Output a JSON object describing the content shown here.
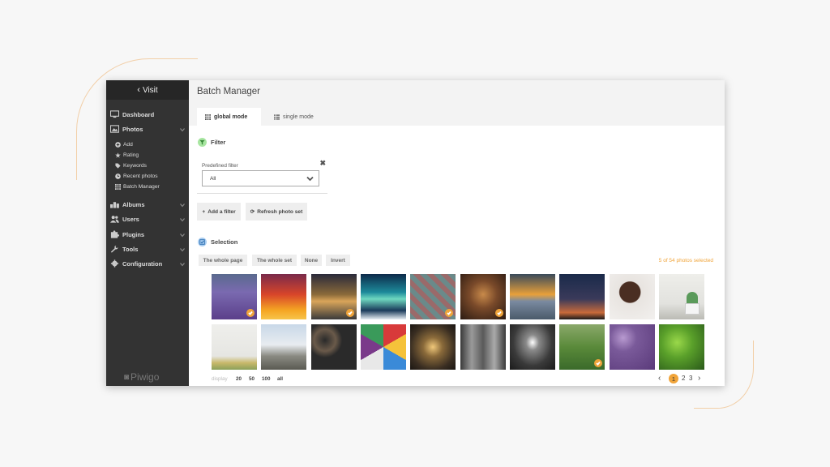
{
  "sidebar": {
    "visit": "Visit",
    "items": [
      {
        "label": "Dashboard",
        "icon": "dashboard-icon"
      },
      {
        "label": "Photos",
        "icon": "photo-icon"
      },
      {
        "label": "Albums",
        "icon": "albums-icon"
      },
      {
        "label": "Users",
        "icon": "users-icon"
      },
      {
        "label": "Plugins",
        "icon": "puzzle-icon"
      },
      {
        "label": "Tools",
        "icon": "wrench-icon"
      },
      {
        "label": "Configuration",
        "icon": "gear-icon"
      }
    ],
    "photos_sub": [
      {
        "label": "Add",
        "icon": "plus-circle-icon"
      },
      {
        "label": "Rating",
        "icon": "star-icon"
      },
      {
        "label": "Keywords",
        "icon": "tag-icon"
      },
      {
        "label": "Recent photos",
        "icon": "clock-icon"
      },
      {
        "label": "Batch Manager",
        "icon": "grid-icon"
      }
    ],
    "logo": "Piwigo"
  },
  "header": {
    "title": "Batch Manager",
    "tabs": [
      {
        "label": "global mode",
        "active": true
      },
      {
        "label": "single mode",
        "active": false
      }
    ]
  },
  "filter": {
    "title": "Filter",
    "predefined_label": "Predefined filter",
    "predefined_value": "All",
    "close": "✖",
    "add_filter": "Add a filter",
    "refresh": "Refresh photo set"
  },
  "selection": {
    "title": "Selection",
    "buttons": [
      "The whole page",
      "The whole set",
      "None",
      "Invert"
    ],
    "count": "5 of 54 photos selected"
  },
  "thumbnails": [
    {
      "name": "lavender",
      "checked": true
    },
    {
      "name": "sunset-sky",
      "checked": false
    },
    {
      "name": "lake-sunset",
      "checked": true
    },
    {
      "name": "aurora",
      "checked": false
    },
    {
      "name": "glass-tiles",
      "checked": true
    },
    {
      "name": "tiger",
      "checked": true
    },
    {
      "name": "mountain-mist",
      "checked": false
    },
    {
      "name": "silhouette-dusk",
      "checked": false
    },
    {
      "name": "puppy",
      "checked": false
    },
    {
      "name": "plant-pot",
      "checked": false
    },
    {
      "name": "pineapples",
      "checked": false
    },
    {
      "name": "pelican-pier",
      "checked": false
    },
    {
      "name": "pots-pans",
      "checked": false
    },
    {
      "name": "paint-cans",
      "checked": false
    },
    {
      "name": "metro-tunnel",
      "checked": false
    },
    {
      "name": "escalators",
      "checked": false
    },
    {
      "name": "metro-hall",
      "checked": false
    },
    {
      "name": "grass",
      "checked": true
    },
    {
      "name": "lilac",
      "checked": false
    },
    {
      "name": "green-leaves",
      "checked": false
    }
  ],
  "display": {
    "label": "display",
    "options": [
      "20",
      "50",
      "100",
      "all"
    ]
  },
  "pagination": {
    "prev": "‹",
    "pages": [
      "1",
      "2",
      "3"
    ],
    "current": "1",
    "next": "›"
  },
  "colors": {
    "accent": "#f0a43a",
    "sidebar": "#333333",
    "filter_green": "#a8e6a1",
    "selection_blue": "#a9cdf0"
  }
}
